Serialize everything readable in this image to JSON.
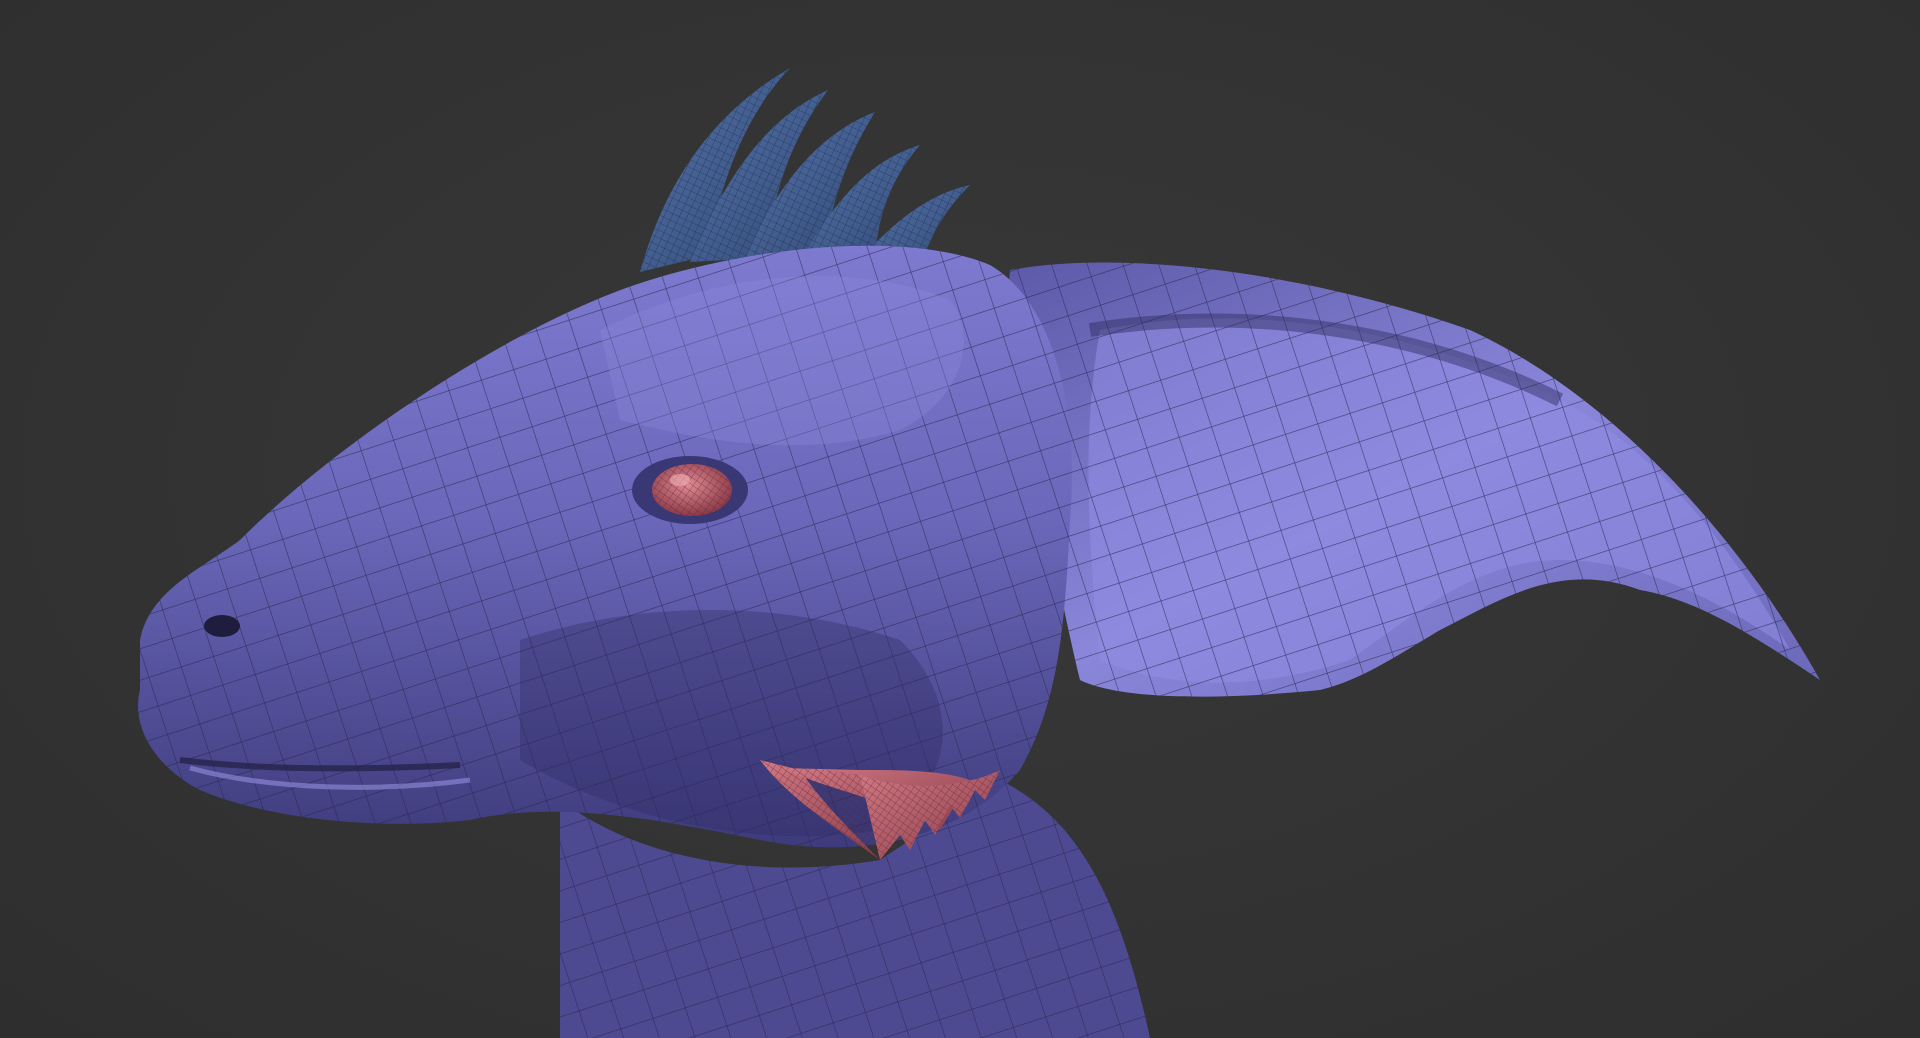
{
  "viewport": {
    "background": "#333333",
    "model": "creature-head-sculpt",
    "display_mode": "polyframe",
    "colors": {
      "skin": "#6f6cbf",
      "skin_dark": "#3d3a7a",
      "skin_light": "#8e8be0",
      "wire": "#26244a",
      "crest": "#4a6aa0",
      "crest_dark": "#2c3f66",
      "eye_gills": "#c2626e",
      "eye_gills_dark": "#7a3540"
    }
  }
}
